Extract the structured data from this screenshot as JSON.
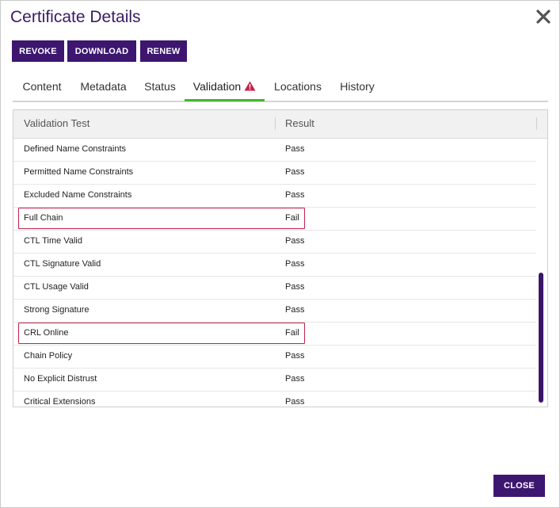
{
  "dialog": {
    "title": "Certificate Details"
  },
  "actions": {
    "revoke": "REVOKE",
    "download": "DOWNLOAD",
    "renew": "RENEW"
  },
  "tabs": [
    {
      "label": "Content"
    },
    {
      "label": "Metadata"
    },
    {
      "label": "Status"
    },
    {
      "label": "Validation",
      "active": true,
      "icon": "warning-icon"
    },
    {
      "label": "Locations"
    },
    {
      "label": "History"
    }
  ],
  "grid": {
    "columns": [
      "Validation Test",
      "Result"
    ],
    "rows": [
      {
        "test": "Defined Name Constraints",
        "result": "Pass"
      },
      {
        "test": "Permitted Name Constraints",
        "result": "Pass"
      },
      {
        "test": "Excluded Name Constraints",
        "result": "Pass"
      },
      {
        "test": "Full Chain",
        "result": "Fail"
      },
      {
        "test": "CTL Time Valid",
        "result": "Pass"
      },
      {
        "test": "CTL Signature Valid",
        "result": "Pass"
      },
      {
        "test": "CTL Usage Valid",
        "result": "Pass"
      },
      {
        "test": "Strong Signature",
        "result": "Pass"
      },
      {
        "test": "CRL Online",
        "result": "Fail"
      },
      {
        "test": "Chain Policy",
        "result": "Pass"
      },
      {
        "test": "No Explicit Distrust",
        "result": "Pass"
      },
      {
        "test": "Critical Extensions",
        "result": "Pass"
      }
    ]
  },
  "footer": {
    "close": "CLOSE"
  },
  "colors": {
    "brand": "#3d1670",
    "active_tab": "#47b52e",
    "fail_outline": "#c4234a",
    "warning": "#c4234a"
  }
}
